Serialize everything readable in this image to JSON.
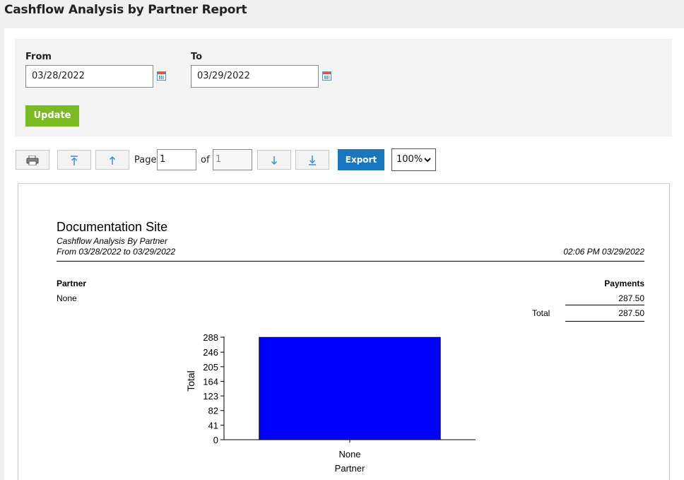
{
  "page": {
    "title": "Cashflow Analysis by Partner Report"
  },
  "filters": {
    "from_label": "From",
    "from_value": "03/28/2022",
    "to_label": "To",
    "to_value": "03/29/2022",
    "update_label": "Update"
  },
  "toolbar": {
    "page_label": "Page",
    "page_value": "1",
    "of_label": "of",
    "total_pages": "1",
    "export_label": "Export",
    "zoom_value": "100%",
    "icons": [
      "print-icon",
      "first-page-icon",
      "previous-page-icon",
      "next-page-icon",
      "last-page-icon"
    ]
  },
  "report": {
    "site_name": "Documentation Site",
    "report_name": "Cashflow Analysis By Partner",
    "date_range": "From 03/28/2022 to 03/29/2022",
    "generated_at": "02:06 PM 03/29/2022",
    "columns": {
      "partner": "Partner",
      "payments": "Payments"
    },
    "rows": [
      {
        "partner": "None",
        "payments": "287.50"
      }
    ],
    "total_label": "Total",
    "total_value": "287.50"
  },
  "chart_data": {
    "type": "bar",
    "categories": [
      "None"
    ],
    "values": [
      287.5
    ],
    "xlabel": "Partner",
    "ylabel": "Total",
    "yticks": [
      0,
      41,
      82,
      123,
      164,
      205,
      246,
      288
    ],
    "ylim": [
      0,
      288
    ],
    "bar_color": "#0000ff",
    "grid": false
  }
}
